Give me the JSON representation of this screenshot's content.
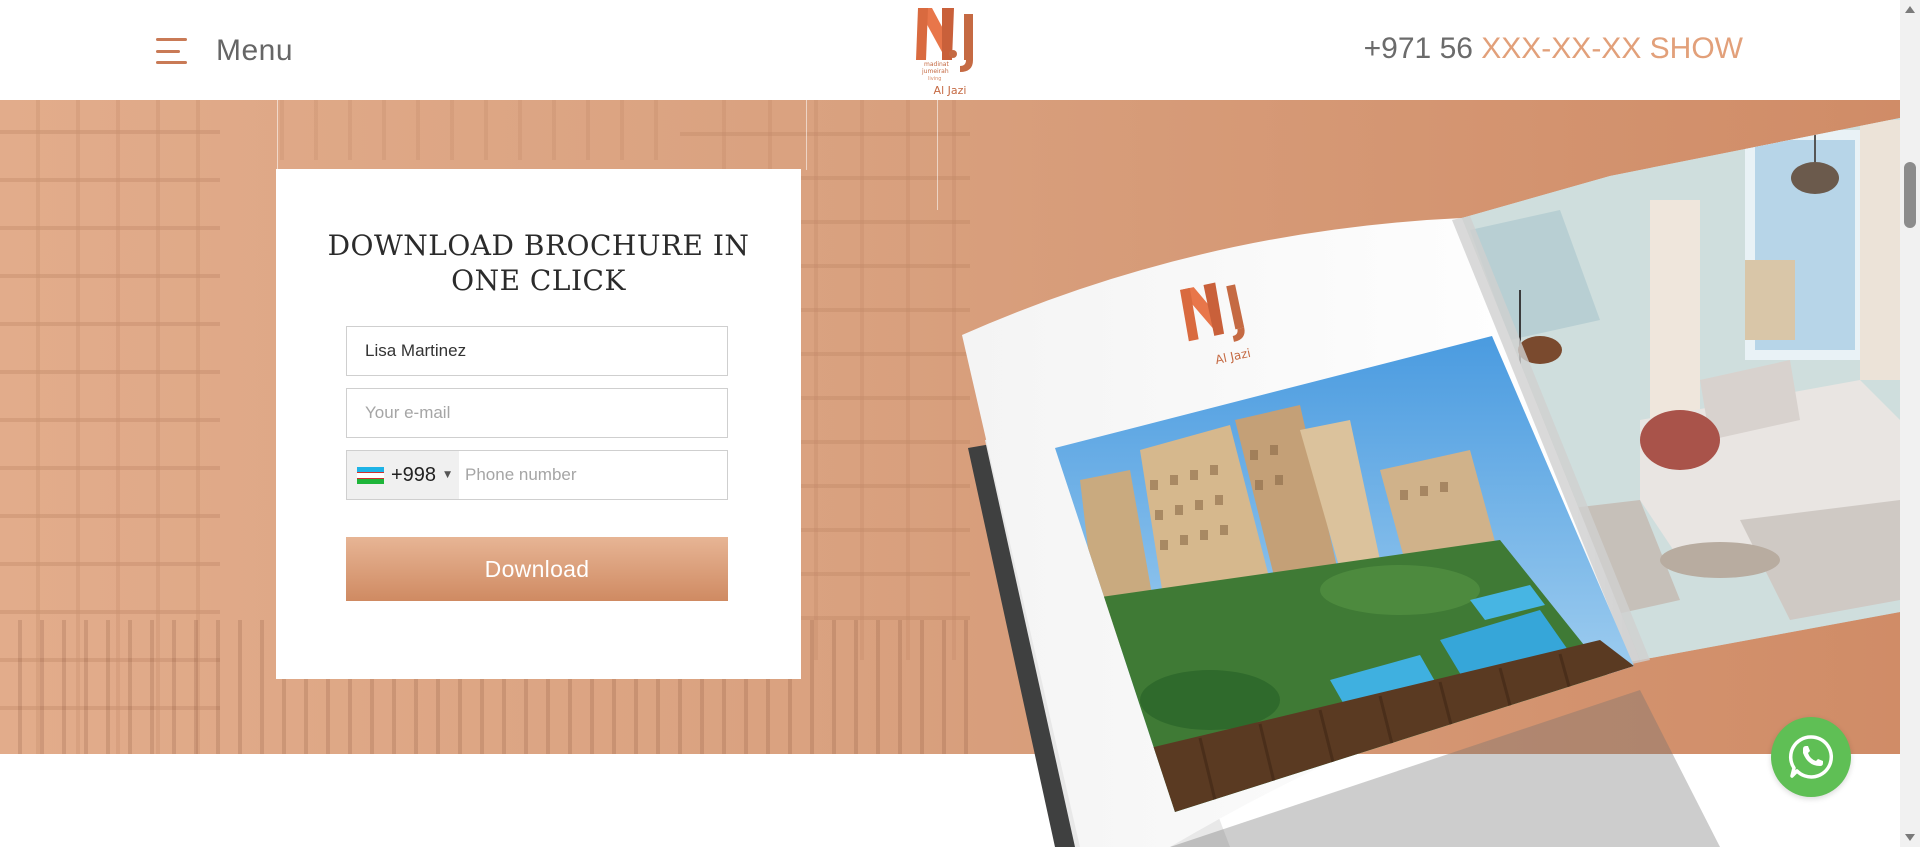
{
  "header": {
    "menu_label": "Menu",
    "logo_name": "Al Jazi",
    "phone_prefix": "+971 56",
    "phone_masked": "XXX-XX-XX SHOW"
  },
  "form": {
    "title_line1": "DOWNLOAD BROCHURE IN",
    "title_line2": "ONE CLICK",
    "name_value": "Lisa Martinez",
    "email_placeholder": "Your e-mail",
    "country_dial": "+998",
    "phone_placeholder": "Phone number",
    "submit_label": "Download"
  },
  "brochure": {
    "logo_name": "Al Jazi"
  },
  "colors": {
    "accent": "#c97a56",
    "phone_show": "#e2a07a",
    "hero_bg": "#d9a17f",
    "button_top": "#e7b595",
    "button_bottom": "#cf8a62",
    "whatsapp": "#5fbf55"
  },
  "icons": {
    "menu": "hamburger-icon",
    "country": "uzbekistan-flag-icon",
    "chat": "whatsapp-icon"
  }
}
